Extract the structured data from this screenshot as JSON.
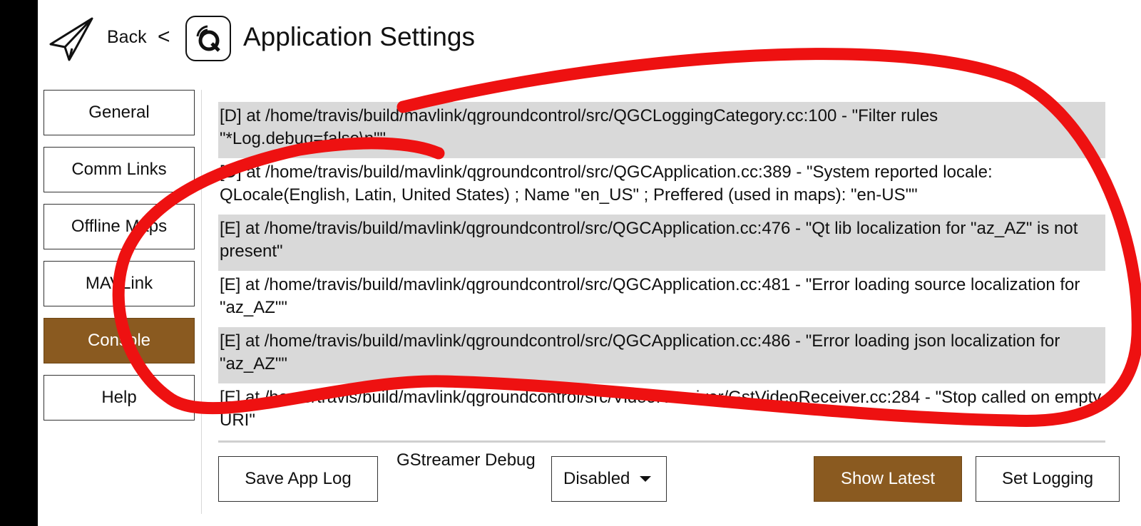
{
  "header": {
    "back_label": "Back",
    "chevron": "<",
    "title": "Application Settings",
    "back_icon": "paper-plane-icon",
    "app_icon": "qgc-logo-icon"
  },
  "sidebar": {
    "items": [
      {
        "label": "General",
        "active": false
      },
      {
        "label": "Comm Links",
        "active": false
      },
      {
        "label": "Offline Maps",
        "active": false
      },
      {
        "label": "MAVLink",
        "active": false
      },
      {
        "label": "Console",
        "active": true
      },
      {
        "label": "Help",
        "active": false
      }
    ]
  },
  "console": {
    "lines": [
      "[D] at /home/travis/build/mavlink/qgroundcontrol/src/QGCLoggingCategory.cc:100 - \"Filter rules \"*Log.debug=false\\n\"\"",
      "[D] at /home/travis/build/mavlink/qgroundcontrol/src/QGCApplication.cc:389 - \"System reported locale: QLocale(English, Latin, United States) ; Name \"en_US\" ; Preffered (used in maps):  \"en-US\"\"",
      "[E] at /home/travis/build/mavlink/qgroundcontrol/src/QGCApplication.cc:476 - \"Qt lib localization for \"az_AZ\" is not present\"",
      "[E] at /home/travis/build/mavlink/qgroundcontrol/src/QGCApplication.cc:481 - \"Error loading source localization for \"az_AZ\"\"",
      "[E] at /home/travis/build/mavlink/qgroundcontrol/src/QGCApplication.cc:486 - \"Error loading json localization for \"az_AZ\"\"",
      "[E] at /home/travis/build/mavlink/qgroundcontrol/src/VideoReceiver/GstVideoReceiver.cc:284 - \"Stop called on empty URI\""
    ]
  },
  "bottom": {
    "save_log": "Save App Log",
    "gstreamer_label": "GStreamer Debug",
    "gstreamer_value": "Disabled",
    "show_latest": "Show Latest",
    "set_logging": "Set Logging"
  },
  "colors": {
    "accent": "#8a5a20",
    "row_shade": "#d9d9d9",
    "annotation": "#ee1111"
  }
}
